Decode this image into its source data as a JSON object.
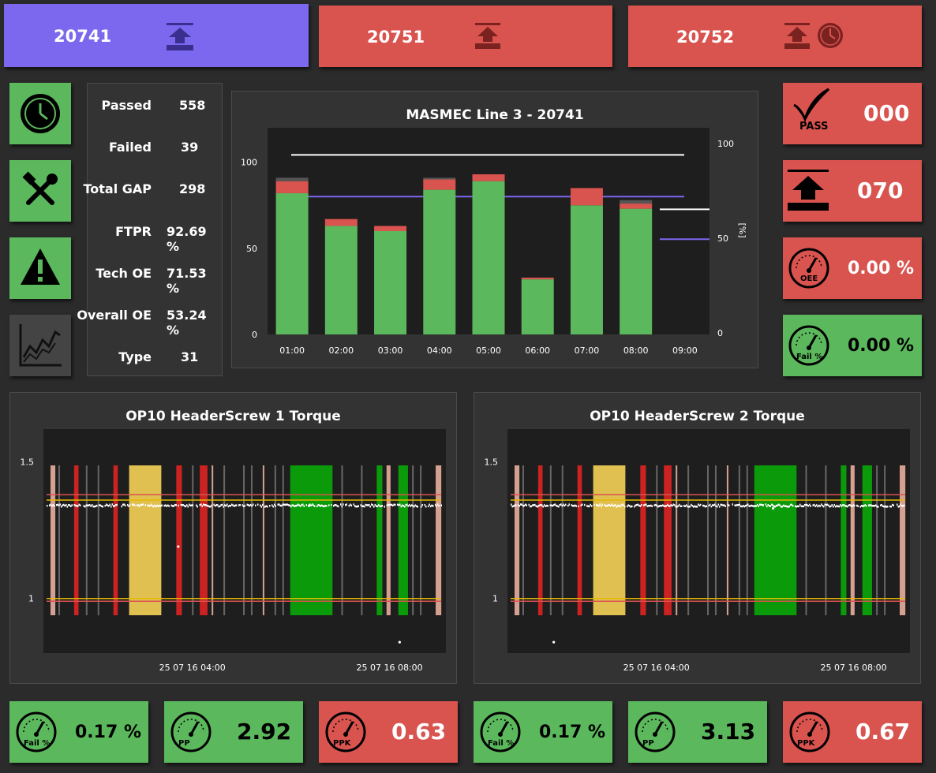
{
  "stations": [
    {
      "id": "20741",
      "color": "#7b68ee"
    },
    {
      "id": "20751",
      "color": "#d9534f"
    },
    {
      "id": "20752",
      "color": "#d9534f"
    }
  ],
  "left_nav": [
    {
      "name": "clock-nav-button",
      "icon": "clock-icon",
      "color": "#5cb85c"
    },
    {
      "name": "tools-nav-button",
      "icon": "tools-icon",
      "color": "#5cb85c"
    },
    {
      "name": "warning-nav-button",
      "icon": "warning-icon",
      "color": "#5cb85c"
    },
    {
      "name": "trend-nav-button",
      "icon": "trend-chart-icon",
      "color": "#444444"
    }
  ],
  "stats": [
    {
      "label": "Passed",
      "value": "558"
    },
    {
      "label": "Failed",
      "value": "39"
    },
    {
      "label": "Total GAP",
      "value": "298"
    },
    {
      "label": "FTPR",
      "value": "92.69 %"
    },
    {
      "label": "Tech OE",
      "value": "71.53 %"
    },
    {
      "label": "Overall OE",
      "value": "53.24 %"
    },
    {
      "label": "Type",
      "value": "31"
    }
  ],
  "right_kpis": [
    {
      "icon": "checkmark-pass-icon",
      "icon_text": "PASS",
      "value": "000",
      "color": "#d9534f"
    },
    {
      "icon": "upload-icon",
      "icon_text": "",
      "value": "070",
      "color": "#d9534f"
    },
    {
      "icon": "gauge-icon",
      "icon_text": "OEE",
      "value": "0.00 %",
      "color": "#d9534f"
    },
    {
      "icon": "gauge-icon",
      "icon_text": "Fail %",
      "value": "0.00 %",
      "color": "#5cb85c"
    }
  ],
  "bottom_kpis": [
    {
      "icon": "gauge-icon",
      "icon_text": "Fail %",
      "value": "0.17 %",
      "color": "#5cb85c"
    },
    {
      "icon": "gauge-icon",
      "icon_text": "PP",
      "value": "2.92",
      "color": "#5cb85c"
    },
    {
      "icon": "gauge-icon",
      "icon_text": "PPK",
      "value": "0.63",
      "color": "#d9534f"
    },
    {
      "icon": "gauge-icon",
      "icon_text": "Fail %",
      "value": "0.17 %",
      "color": "#5cb85c"
    },
    {
      "icon": "gauge-icon",
      "icon_text": "PP",
      "value": "3.13",
      "color": "#5cb85c"
    },
    {
      "icon": "gauge-icon",
      "icon_text": "PPK",
      "value": "0.67",
      "color": "#d9534f"
    }
  ],
  "chart_data": [
    {
      "type": "bar",
      "title": "MASMEC Line 3 - 20741",
      "categories": [
        "01:00",
        "02:00",
        "03:00",
        "04:00",
        "05:00",
        "06:00",
        "07:00",
        "08:00",
        "09:00"
      ],
      "series": [
        {
          "color": "#5cb85c",
          "values": [
            82,
            63,
            60,
            84,
            89,
            32,
            75,
            73,
            0
          ]
        },
        {
          "color": "#d9534f",
          "values": [
            7,
            4,
            3,
            6,
            4,
            1,
            10,
            3,
            0
          ]
        },
        {
          "color": "#555555",
          "values": [
            2,
            0,
            0,
            1,
            0,
            0,
            0,
            2,
            0
          ]
        }
      ],
      "ylim": [
        0,
        120
      ],
      "yticks": [
        "0",
        "50",
        "100"
      ],
      "y2label": "[%]",
      "y2lim": [
        0,
        100
      ],
      "y2ticks": [
        "0",
        "50",
        "100"
      ],
      "reference_lines": [
        {
          "color": "#ffffff",
          "y2": 94
        },
        {
          "color": "#7b68ee",
          "y2": 72
        }
      ]
    },
    {
      "type": "scatter",
      "title": "OP10 HeaderScrew 1 Torque",
      "x_ticks": [
        "25 07 16 04:00",
        "25 07 16 08:00"
      ],
      "ylim": [
        0.8,
        1.62
      ],
      "yticks": [
        "1",
        "1.5"
      ],
      "limit_lines": [
        {
          "color": "#d9534f",
          "y": 1.38
        },
        {
          "color": "#e6b800",
          "y": 1.36
        },
        {
          "color": "#e6b800",
          "y": 1.0
        },
        {
          "color": "#d9534f",
          "y": 0.99
        }
      ],
      "main_level": 1.34,
      "outliers": [
        {
          "x": 0.335,
          "y": 1.19
        },
        {
          "x": 0.66,
          "y": 1.34
        },
        {
          "x": 0.885,
          "y": 0.84
        }
      ]
    },
    {
      "type": "scatter",
      "title": "OP10 HeaderScrew 2 Torque",
      "x_ticks": [
        "25 07 16 04:00",
        "25 07 16 08:00"
      ],
      "ylim": [
        0.8,
        1.62
      ],
      "yticks": [
        "1",
        "1.5"
      ],
      "limit_lines": [
        {
          "color": "#d9534f",
          "y": 1.38
        },
        {
          "color": "#e6b800",
          "y": 1.36
        },
        {
          "color": "#e6b800",
          "y": 1.0
        },
        {
          "color": "#d9534f",
          "y": 0.99
        }
      ],
      "main_level": 1.34,
      "outliers": [
        {
          "x": 0.115,
          "y": 0.84
        },
        {
          "x": 0.66,
          "y": 1.33
        }
      ]
    }
  ]
}
